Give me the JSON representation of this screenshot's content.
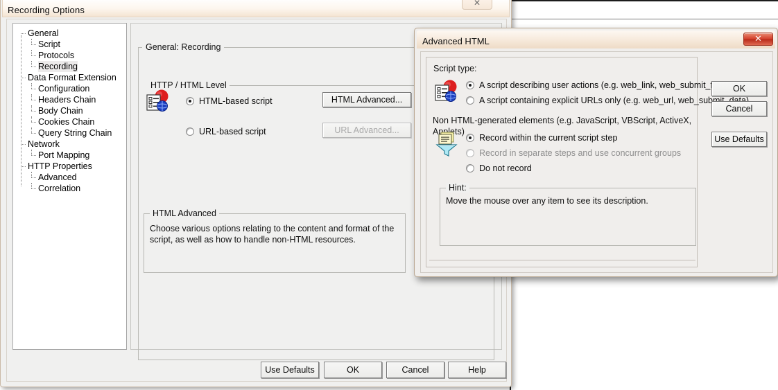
{
  "background": {
    "window_name": "background-app-window"
  },
  "main_dialog": {
    "title": "Recording Options",
    "close_glyph": "✕",
    "tree": {
      "items": [
        {
          "label": "General",
          "depth": 0,
          "selected": false
        },
        {
          "label": "Script",
          "depth": 1,
          "selected": false
        },
        {
          "label": "Protocols",
          "depth": 1,
          "selected": false
        },
        {
          "label": "Recording",
          "depth": 1,
          "selected": true
        },
        {
          "label": "Data Format Extension",
          "depth": 0,
          "selected": false
        },
        {
          "label": "Configuration",
          "depth": 1,
          "selected": false
        },
        {
          "label": "Headers Chain",
          "depth": 1,
          "selected": false
        },
        {
          "label": "Body Chain",
          "depth": 1,
          "selected": false
        },
        {
          "label": "Cookies Chain",
          "depth": 1,
          "selected": false
        },
        {
          "label": "Query String Chain",
          "depth": 1,
          "selected": false
        },
        {
          "label": "Network",
          "depth": 0,
          "selected": false
        },
        {
          "label": "Port Mapping",
          "depth": 1,
          "selected": false
        },
        {
          "label": "HTTP Properties",
          "depth": 0,
          "selected": false
        },
        {
          "label": "Advanced",
          "depth": 1,
          "selected": false
        },
        {
          "label": "Correlation",
          "depth": 1,
          "selected": false
        }
      ]
    },
    "content": {
      "header": "General: Recording",
      "http_html_level": {
        "group_title": "HTTP / HTML Level",
        "icon": "recording-script-icon",
        "options": [
          {
            "label": "HTML-based script",
            "selected": true
          },
          {
            "label": "URL-based script",
            "selected": false
          }
        ],
        "buttons": [
          {
            "label": "HTML Advanced...",
            "enabled": true
          },
          {
            "label": "URL Advanced...",
            "enabled": false
          }
        ]
      },
      "html_advanced_group": {
        "group_title": "HTML Advanced",
        "description": "Choose various options relating to the content and format of the script, as well as how to handle non-HTML resources."
      }
    },
    "footer_buttons": [
      {
        "label": "Use Defaults"
      },
      {
        "label": "OK"
      },
      {
        "label": "Cancel"
      },
      {
        "label": "Help"
      }
    ]
  },
  "advanced_dialog": {
    "title": "Advanced HTML",
    "close_glyph": "✕",
    "script_type": {
      "label": "Script type:",
      "icon": "recording-script-icon",
      "options": [
        {
          "label": "A script describing user actions (e.g. web_link, web_submit_form)",
          "selected": true,
          "dim": false
        },
        {
          "label": "A script containing explicit URLs only (e.g. web_url, web_submit_data)",
          "selected": false,
          "dim": false
        }
      ]
    },
    "non_html": {
      "label": "Non HTML-generated elements (e.g. JavaScript, VBScript, ActiveX, Applets)",
      "icon": "document-funnel-icon",
      "options": [
        {
          "label": "Record within the current script step",
          "selected": true,
          "dim": false
        },
        {
          "label": "Record in separate steps and use concurrent groups",
          "selected": false,
          "dim": true
        },
        {
          "label": "Do not record",
          "selected": false,
          "dim": false
        }
      ]
    },
    "hint": {
      "group_title": "Hint:",
      "text": "Move the mouse over any item to see its description."
    },
    "buttons": [
      {
        "label": "OK"
      },
      {
        "label": "Cancel"
      },
      {
        "label": "Use Defaults"
      }
    ]
  },
  "colors": {
    "dialog_face": "#f0f0ef",
    "titlebar_tan": "#f4e4d2",
    "close_red": "#d3402c",
    "tree_panel": "#ffffff",
    "icon_red": "#dd1e1e",
    "icon_blue": "#1c3fbf",
    "icon_cyan": "#8fe2f0",
    "icon_yellow": "#f7f0a8"
  }
}
